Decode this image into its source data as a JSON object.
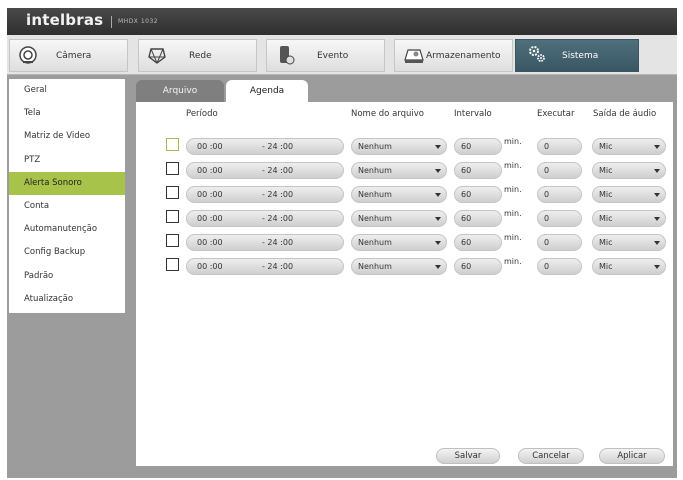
{
  "header": {
    "brand": "intelbras",
    "model": "MHDX 1032"
  },
  "main_tabs": [
    {
      "label": "Câmera",
      "icon": "camera-icon"
    },
    {
      "label": "Rede",
      "icon": "network-icon"
    },
    {
      "label": "Evento",
      "icon": "event-icon"
    },
    {
      "label": "Armazenamento",
      "icon": "storage-icon"
    },
    {
      "label": "Sistema",
      "icon": "system-gear-icon",
      "active": true
    }
  ],
  "sidebar": {
    "items": [
      {
        "label": "Geral"
      },
      {
        "label": "Tela"
      },
      {
        "label": "Matriz de Video"
      },
      {
        "label": "PTZ"
      },
      {
        "label": "Alerta Sonoro",
        "active": true
      },
      {
        "label": "Conta"
      },
      {
        "label": "Automanutenção"
      },
      {
        "label": "Config Backup"
      },
      {
        "label": "Padrão"
      },
      {
        "label": "Atualização"
      }
    ]
  },
  "content_tabs": [
    {
      "label": "Arquivo",
      "active": false
    },
    {
      "label": "Agenda",
      "active": true
    }
  ],
  "columns": {
    "periodo": "Período",
    "nome": "Nome do arquivo",
    "intervalo": "Intervalo",
    "executar": "Executar",
    "saida": "Saída de áudio"
  },
  "rows": [
    {
      "checked": false,
      "start": "00 :00",
      "end": "- 24 :00",
      "file": "Nenhum",
      "interval": "60",
      "unit": "min.",
      "execute": "0",
      "audio": "Mic"
    },
    {
      "checked": false,
      "start": "00 :00",
      "end": "- 24 :00",
      "file": "Nenhum",
      "interval": "60",
      "unit": "min.",
      "execute": "0",
      "audio": "Mic"
    },
    {
      "checked": false,
      "start": "00 :00",
      "end": "- 24 :00",
      "file": "Nenhum",
      "interval": "60",
      "unit": "min.",
      "execute": "0",
      "audio": "Mic"
    },
    {
      "checked": false,
      "start": "00 :00",
      "end": "- 24 :00",
      "file": "Nenhum",
      "interval": "60",
      "unit": "min.",
      "execute": "0",
      "audio": "Mic"
    },
    {
      "checked": false,
      "start": "00 :00",
      "end": "- 24 :00",
      "file": "Nenhum",
      "interval": "60",
      "unit": "min.",
      "execute": "0",
      "audio": "Mic"
    },
    {
      "checked": false,
      "start": "00 :00",
      "end": "- 24 :00",
      "file": "Nenhum",
      "interval": "60",
      "unit": "min.",
      "execute": "0",
      "audio": "Mic"
    }
  ],
  "buttons": {
    "save": "Salvar",
    "cancel": "Cancelar",
    "apply": "Aplicar"
  },
  "colors": {
    "accent_green": "#a8c34a",
    "active_tab": "#3a5663",
    "topbar": "#3a3a3a"
  }
}
